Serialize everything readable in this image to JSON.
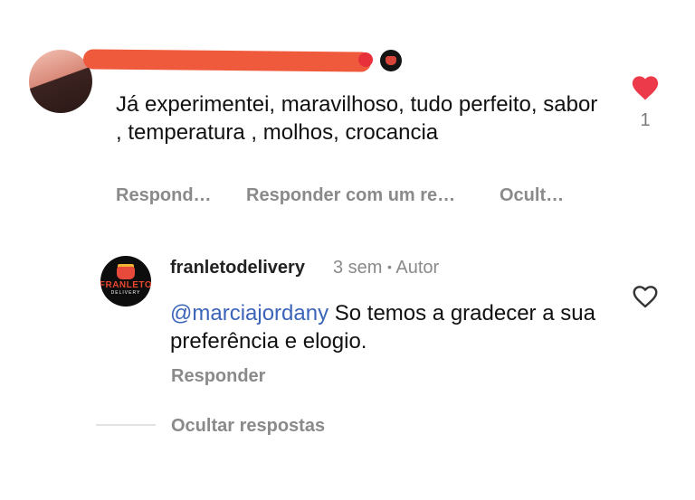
{
  "comment": {
    "text": "Já experimentei, maravilhoso, tudo perfeito, sabor , temperatura , molhos, crocancia",
    "actions": {
      "reply": "Respond…",
      "reply_with_reel": "Responder com um re…",
      "hide": "Ocult…"
    },
    "like_count": "1"
  },
  "reply": {
    "username": "franletodelivery",
    "time": "3 sem",
    "separator": "•",
    "author_label": "Autor",
    "mention": "@marciajordany",
    "text": " So temos a gradecer a sua preferência e elogio.",
    "reply_label": "Responder",
    "logo_word": "FRANLETO",
    "logo_sub": "DELIVERY"
  },
  "hide_replies_label": "Ocultar respostas",
  "colors": {
    "like_red": "#ed3a4a",
    "mention_blue": "#3b64b8",
    "redaction": "#f05a3c"
  },
  "icons": [
    "heart-filled-icon",
    "heart-outline-icon"
  ]
}
